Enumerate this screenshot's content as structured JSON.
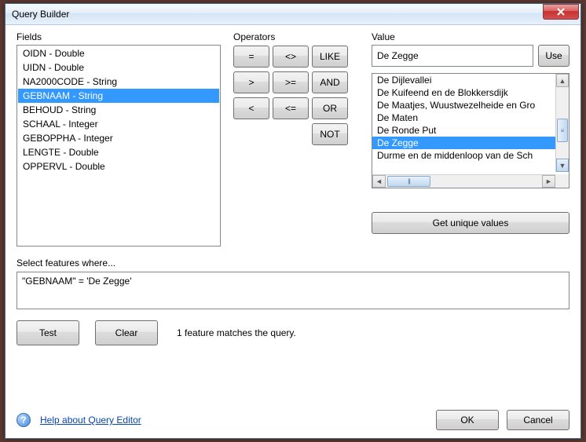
{
  "window": {
    "title": "Query Builder"
  },
  "labels": {
    "fields": "Fields",
    "operators": "Operators",
    "value": "Value",
    "select_where": "Select features where...",
    "help_link": "Help about Query Editor"
  },
  "fields": {
    "items": [
      "OIDN - Double",
      "UIDN - Double",
      "NA2000CODE - String",
      "GEBNAAM - String",
      "BEHOUD - String",
      "SCHAAL - Integer",
      "GEBOPPHA - Integer",
      "LENGTE - Double",
      "OPPERVL - Double"
    ],
    "selected_index": 3
  },
  "operators": {
    "eq": "=",
    "ne": "<>",
    "like": "LIKE",
    "gt": ">",
    "ge": ">=",
    "and": "AND",
    "lt": "<",
    "le": "<=",
    "or": "OR",
    "not": "NOT"
  },
  "value": {
    "input": "De Zegge",
    "use": "Use",
    "items": [
      "De Dijlevallei",
      "De Kuifeend en de Blokkersdijk",
      "De Maatjes, Wuustwezelheide en Gro",
      "De Maten",
      "De Ronde Put",
      "De Zegge",
      "Durme en de middenloop van de Sch"
    ],
    "selected_index": 5,
    "get_unique": "Get unique values"
  },
  "query": {
    "text": "\"GEBNAAM\" = 'De Zegge'"
  },
  "buttons": {
    "test": "Test",
    "clear": "Clear",
    "ok": "OK",
    "cancel": "Cancel"
  },
  "status": {
    "text": "1 feature matches the query."
  }
}
